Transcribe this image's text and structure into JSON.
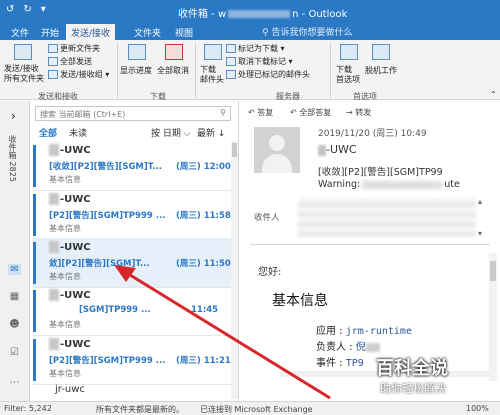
{
  "window": {
    "title_left": "收件箱 - w",
    "title_right": "n - Outlook",
    "quick_access": [
      "↺",
      "↻",
      "▾"
    ]
  },
  "ribbon_tabs": [
    {
      "label": "文件"
    },
    {
      "label": "开始"
    },
    {
      "label": "发送/接收",
      "active": true
    },
    {
      "label": "文件夹"
    },
    {
      "label": "视图"
    }
  ],
  "tell_me": "告诉我你想要做什么",
  "ribbon": {
    "send_receive_all": "发送/接收\n所有文件夹",
    "update_folder": "更新文件夹",
    "send_all": "全部发送",
    "send_receive_groups": "发送/接收组",
    "group_send_receive": "发送和接收",
    "show_progress": "显示进度",
    "cancel_all": "全部取消",
    "download_headers": "下载\n邮件头",
    "group_download": "下载",
    "mark_download": "标记为下载",
    "unmark_download": "取消下载标记",
    "process_headers": "处理已标记的邮件头",
    "group_server": "服务器",
    "download_prefs": "下载\n首选项",
    "work_offline": "脱机工作",
    "group_prefs": "首选项"
  },
  "nav": {
    "collapse_arrow": "›",
    "folder_label": "收件箱 2825"
  },
  "list": {
    "search_placeholder": "搜索 当前邮箱 (Ctrl+E)",
    "filter_all": "全部",
    "filter_unread": "未读",
    "sort_by": "按 日期 ⌵",
    "sort_order": "最新 ↓",
    "mails": [
      {
        "sender": "-UWC",
        "subject": "[收敛][P2][警告][SGM]T...",
        "time": "(周三) 12:00",
        "preview": "基本信息"
      },
      {
        "sender": "-UWC",
        "subject": "[P2][警告][SGM]TP999 ...",
        "time": "(周三) 11:58",
        "preview": "基本信息"
      },
      {
        "sender": "-UWC",
        "subject": "敛][P2][警告][SGM]T...",
        "time": "(周三) 11:50",
        "preview": "基本信息"
      },
      {
        "sender": "-UWC",
        "subject": "[SGM]TP999 ...",
        "time": "11:45",
        "preview": "基本信息"
      },
      {
        "sender": "-UWC",
        "subject": "[P2][警告][SGM]TP999 ...",
        "time": "(周三) 11:21",
        "preview": "基本信息"
      }
    ],
    "last_sender": "jr-uwc"
  },
  "reading": {
    "reply": "答复",
    "reply_all": "全部答复",
    "forward": "转发",
    "date": "2019/11/20 (周三) 10:49",
    "sender": "-UWC",
    "subject": "[收敛][P2][警告][SGM]TP99",
    "warning_start": "Warning:",
    "warning_end": "ute",
    "to_label": "收件人",
    "greeting": "您好:",
    "heading": "基本信息",
    "fields": [
      {
        "key": "应用 :",
        "value": "jrm-runtime"
      },
      {
        "key": "负责人 :",
        "value": "倪"
      },
      {
        "key": "事件 :",
        "value": "TP9"
      }
    ]
  },
  "status": {
    "filter": "Filter: 5,242",
    "all_updated": "所有文件夹都是最新的。",
    "connected": "已连接到 Microsoft Exchange",
    "zoom": "100%"
  },
  "watermark": {
    "brand": "百科全说",
    "slogan": "助你轻松解决"
  },
  "colors": {
    "accent": "#2b78c5",
    "arrow": "#d9262a"
  }
}
